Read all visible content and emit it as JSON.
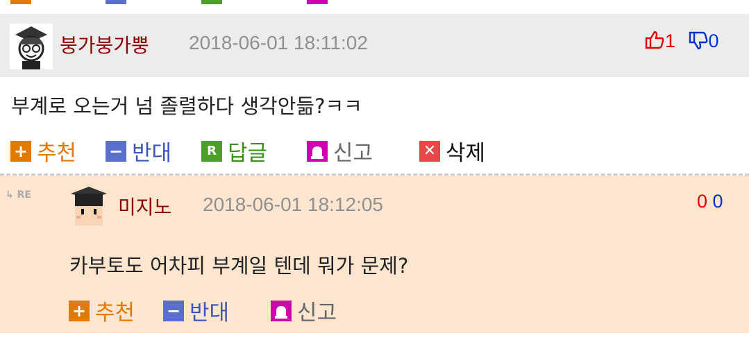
{
  "comment": {
    "nickname": "붕가붕가뿡",
    "date": "2018-06-01 18:11:02",
    "up_count": "1",
    "down_count": "0",
    "text": "부계로 오는거 넘 졸렬하다 생각안듦?ㅋㅋ",
    "actions": {
      "recommend": "추천",
      "oppose": "반대",
      "reply": "답글",
      "report": "신고",
      "delete": "삭제"
    }
  },
  "reply": {
    "re_label": "RE",
    "nickname": "미지노",
    "date": "2018-06-01 18:12:05",
    "up_count": "0",
    "down_count": "0",
    "text": "카부토도 어차피 부계일 텐데 뭐가 문제?",
    "actions": {
      "recommend": "추천",
      "oppose": "반대",
      "report": "신고"
    }
  },
  "colors": {
    "recommend": "#e07a00",
    "oppose": "#3a55c0",
    "reply": "#3c8f1f",
    "report": "#d000b0",
    "delete": "#e84848",
    "nickname": "#8b0000",
    "reply_background": "#fde5cf",
    "header_background": "#ececec"
  }
}
